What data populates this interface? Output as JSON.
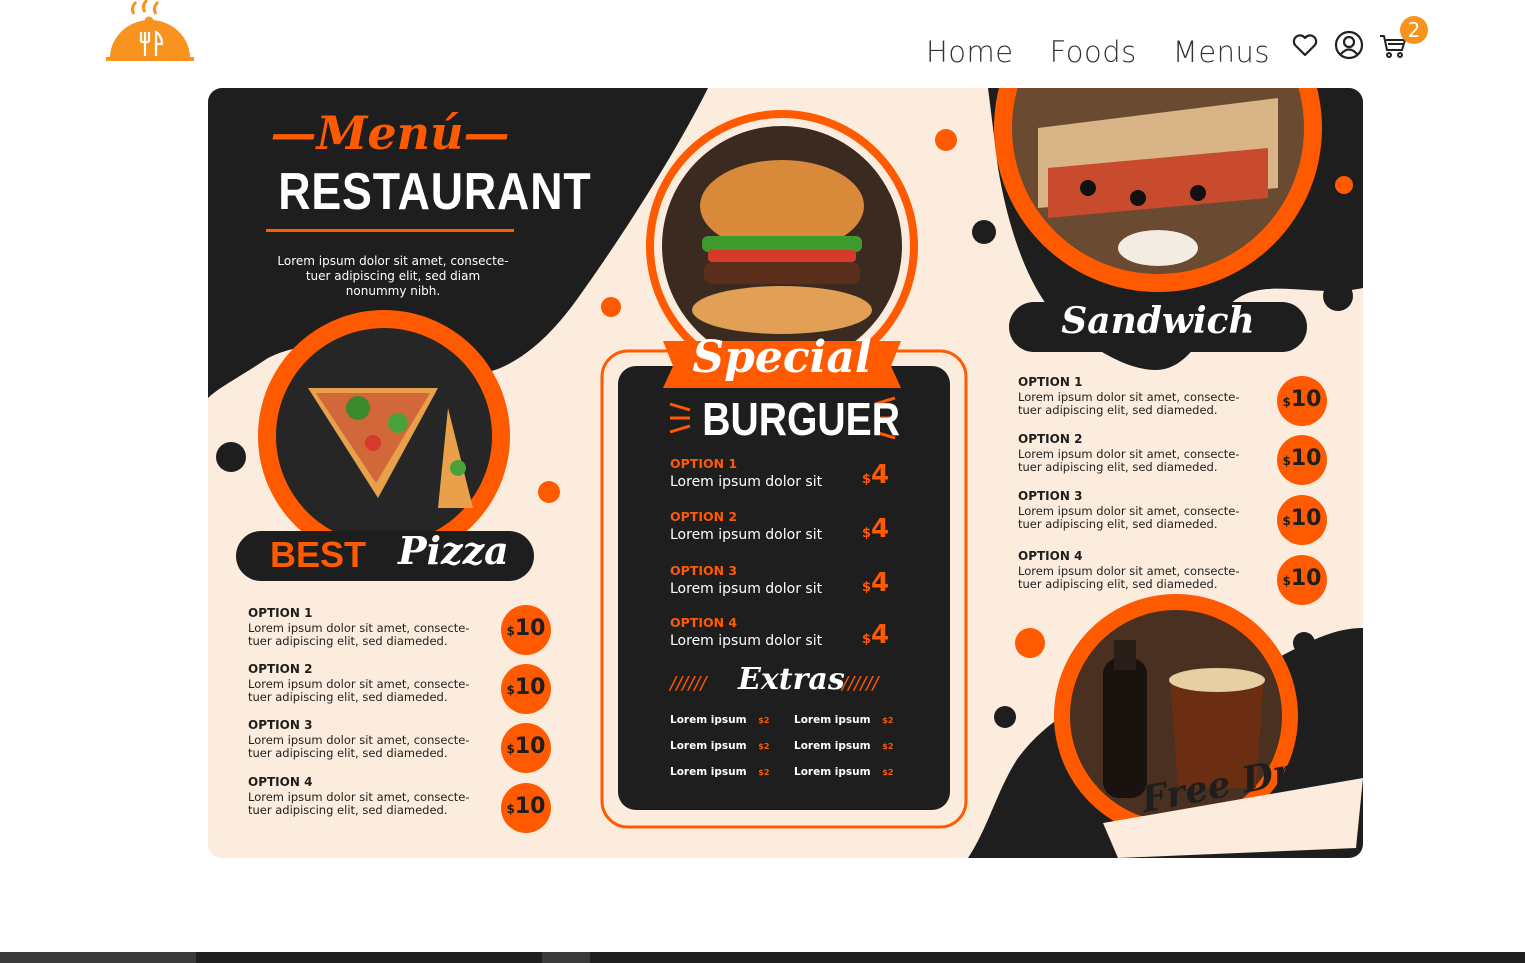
{
  "nav": {
    "items": [
      "Home",
      "Foods",
      "Menus"
    ],
    "cart_count": "2"
  },
  "colors": {
    "accent": "#f7931e",
    "menu_orange": "#ff5a00",
    "menu_dark": "#1e1e1e",
    "menu_cream": "#fcecdd"
  },
  "menu": {
    "title_script": "—Menú—",
    "title": "RESTAURANT",
    "intro": [
      "Lorem ipsum dolor sit amet, consecte-",
      "tuer adipiscing elit, sed diam",
      "nonummy nibh."
    ],
    "pizza": {
      "heading_bold": "BEST",
      "heading_script": "Pizza",
      "options": [
        {
          "name": "OPTION 1",
          "desc1": "Lorem ipsum dolor sit amet, consecte-",
          "desc2": "tuer adipiscing elit, sed diameded.",
          "price": "10"
        },
        {
          "name": "OPTION 2",
          "desc1": "Lorem ipsum dolor sit amet, consecte-",
          "desc2": "tuer adipiscing elit, sed diameded.",
          "price": "10"
        },
        {
          "name": "OPTION 3",
          "desc1": "Lorem ipsum dolor sit amet, consecte-",
          "desc2": "tuer adipiscing elit, sed diameded.",
          "price": "10"
        },
        {
          "name": "OPTION 4",
          "desc1": "Lorem ipsum dolor sit amet, consecte-",
          "desc2": "tuer adipiscing elit, sed diameded.",
          "price": "10"
        }
      ]
    },
    "burger": {
      "heading_script": "Special",
      "heading": "BURGUER",
      "options": [
        {
          "name": "OPTION 1",
          "desc": "Lorem ipsum dolor sit",
          "price": "4"
        },
        {
          "name": "OPTION 2",
          "desc": "Lorem ipsum dolor sit",
          "price": "4"
        },
        {
          "name": "OPTION 3",
          "desc": "Lorem ipsum dolor sit",
          "price": "4"
        },
        {
          "name": "OPTION 4",
          "desc": "Lorem ipsum dolor sit",
          "price": "4"
        }
      ],
      "extras_heading": "Extras",
      "extras_deco": "//////",
      "extras": [
        {
          "label": "Lorem ipsum",
          "price": "$2"
        },
        {
          "label": "Lorem ipsum",
          "price": "$2"
        },
        {
          "label": "Lorem ipsum",
          "price": "$2"
        },
        {
          "label": "Lorem ipsum",
          "price": "$2"
        },
        {
          "label": "Lorem ipsum",
          "price": "$2"
        },
        {
          "label": "Lorem ipsum",
          "price": "$2"
        }
      ]
    },
    "sandwich": {
      "heading_script": "Sandwich",
      "options": [
        {
          "name": "OPTION 1",
          "desc1": "Lorem ipsum dolor sit amet, consecte-",
          "desc2": "tuer adipiscing elit, sed diameded.",
          "price": "10"
        },
        {
          "name": "OPTION 2",
          "desc1": "Lorem ipsum dolor sit amet, consecte-",
          "desc2": "tuer adipiscing elit, sed diameded.",
          "price": "10"
        },
        {
          "name": "OPTION 3",
          "desc1": "Lorem ipsum dolor sit amet, consecte-",
          "desc2": "tuer adipiscing elit, sed diameded.",
          "price": "10"
        },
        {
          "name": "OPTION 4",
          "desc1": "Lorem ipsum dolor sit amet, consecte-",
          "desc2": "tuer adipiscing elit, sed diameded.",
          "price": "10"
        }
      ]
    },
    "drink_banner": "Free Drink!",
    "currency": "$"
  }
}
